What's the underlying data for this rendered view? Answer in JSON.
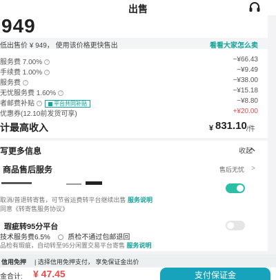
{
  "header": {
    "title": "出售"
  },
  "price": {
    "big": "949",
    "hint": "低出售价 ¥ 949， 使用该价格更快售出",
    "hint_link": "看看大家怎么卖"
  },
  "fees": [
    {
      "label": "服务费 7.00%",
      "amount": "−¥66.43"
    },
    {
      "label": "手续费 1.00%",
      "amount": "−¥9.49"
    },
    {
      "label": "服务费",
      "amount": "−¥38.00"
    },
    {
      "label": "无忧服务费 1.60%",
      "amount": "−¥15.18"
    },
    {
      "label": "者邮费补贴",
      "tag": "平台共同补贴",
      "amount": "−¥8.80"
    },
    {
      "label": "优惠券(12.10前发货可享)",
      "amount": "+¥20.00"
    }
  ],
  "total": {
    "label": "计最高收入",
    "currency": "¥",
    "value": "831.10",
    "unit": "/件"
  },
  "more_info": {
    "title": "写更多信息",
    "collapse_label": "收起"
  },
  "aftersale": {
    "title": "商品售后服务",
    "value": "售后无忧"
  },
  "consign": {
    "desc1": "取消/普退转寄售，可节省运费转平台继续出售",
    "link1": "服务说明",
    "desc2": "同意《转寄售服务协议》"
  },
  "flaw": {
    "title": "瑕疵转95分平台",
    "fee": "技术服务费6.5%",
    "option": "质检不通过包邮退回",
    "desc": "品检有瑕疵，自动转至95分闲置交易平台寄售",
    "link": "服务说明"
  },
  "credit": {
    "bold": "信用免押",
    "text": "| 选择信用免押支付， 享免保证金出价"
  },
  "footer": {
    "deposit_label": "金合计:",
    "deposit_amount": "¥ 47.45",
    "pay_label": "支付保证金"
  }
}
